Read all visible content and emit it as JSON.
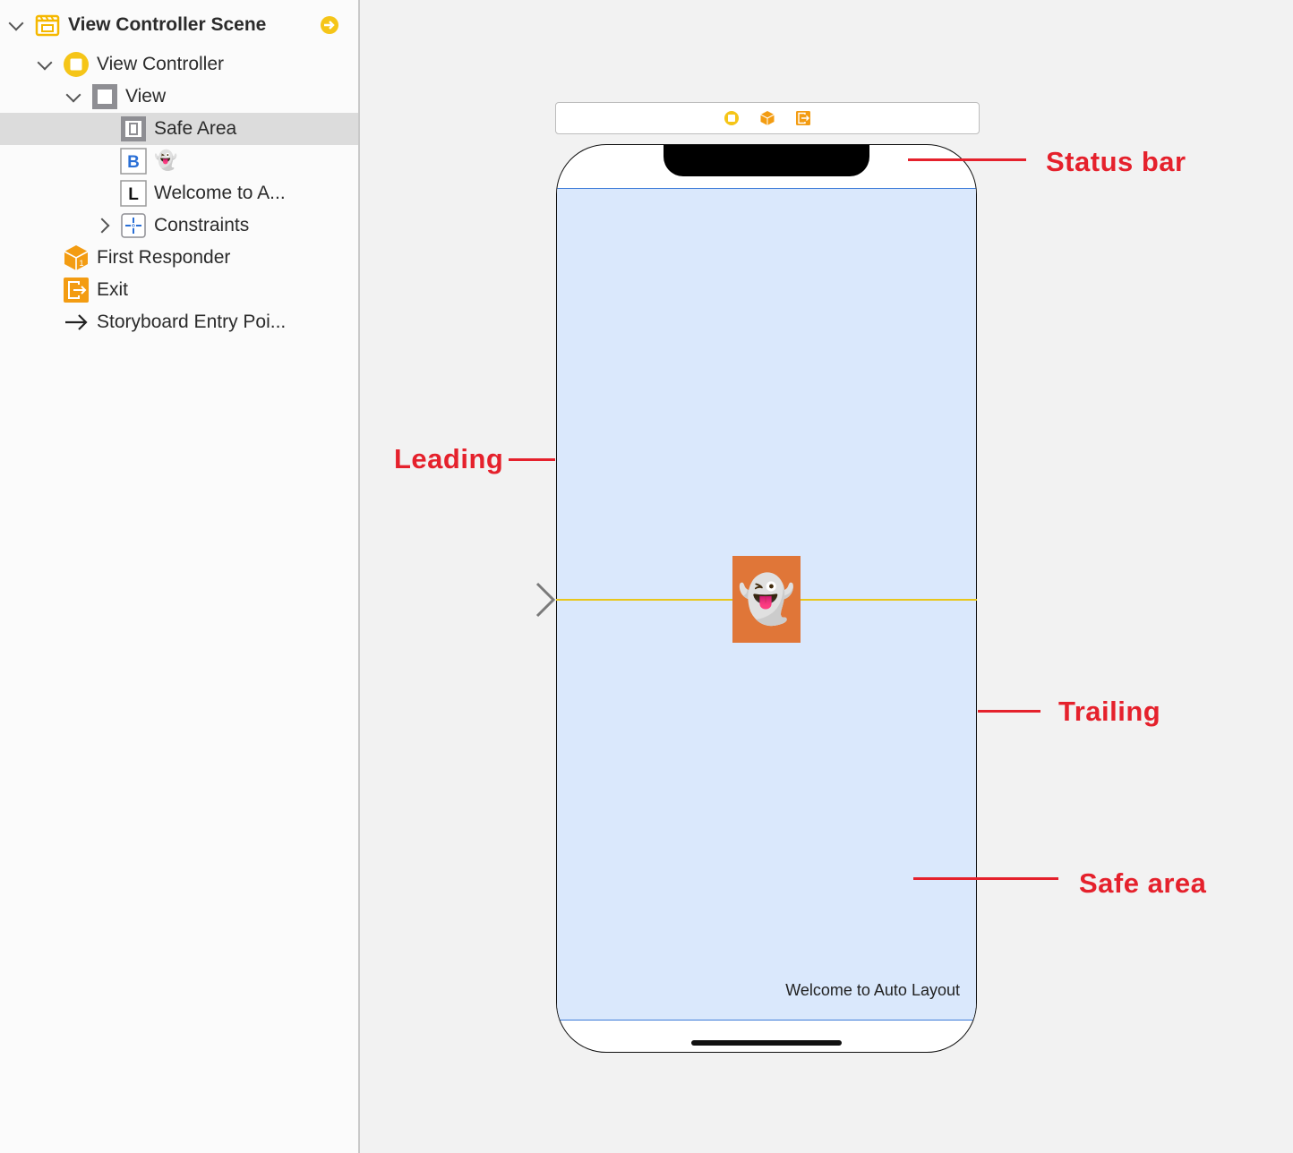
{
  "outline": {
    "scene": {
      "label": "View Controller Scene",
      "expanded": true,
      "icon": "storyboard-scene-icon",
      "accent": "#f5c518"
    },
    "items": [
      {
        "label": "View Controller",
        "icon": "view-controller-icon",
        "expanded": true
      },
      {
        "label": "View",
        "icon": "view-icon",
        "expanded": true
      },
      {
        "label": "Safe Area",
        "icon": "safe-area-icon",
        "selected": true
      },
      {
        "label": "👻",
        "icon": "button-icon",
        "icon_glyph": "B"
      },
      {
        "label": "Welcome to A...",
        "icon": "label-icon",
        "icon_glyph": "L"
      },
      {
        "label": "Constraints",
        "icon": "constraints-icon",
        "expanded": false
      },
      {
        "label": "First Responder",
        "icon": "first-responder-icon"
      },
      {
        "label": "Exit",
        "icon": "exit-icon"
      },
      {
        "label": "Storyboard Entry Poi...",
        "icon": "arrow-right-icon",
        "icon_glyph": "→"
      }
    ]
  },
  "canvas": {
    "scene_dock_icons": [
      "view-controller-icon",
      "first-responder-icon",
      "exit-icon"
    ],
    "ghost_button": {
      "text": "👻",
      "background": "#e07638"
    },
    "welcome_label": "Welcome to Auto Layout",
    "safe_area_color": "#dae8fc",
    "guide_color": "#e8c61a"
  },
  "annotations": {
    "color": "#e5212c",
    "status_bar": "Status bar",
    "leading": "Leading",
    "trailing": "Trailing",
    "safe_area": "Safe area"
  }
}
